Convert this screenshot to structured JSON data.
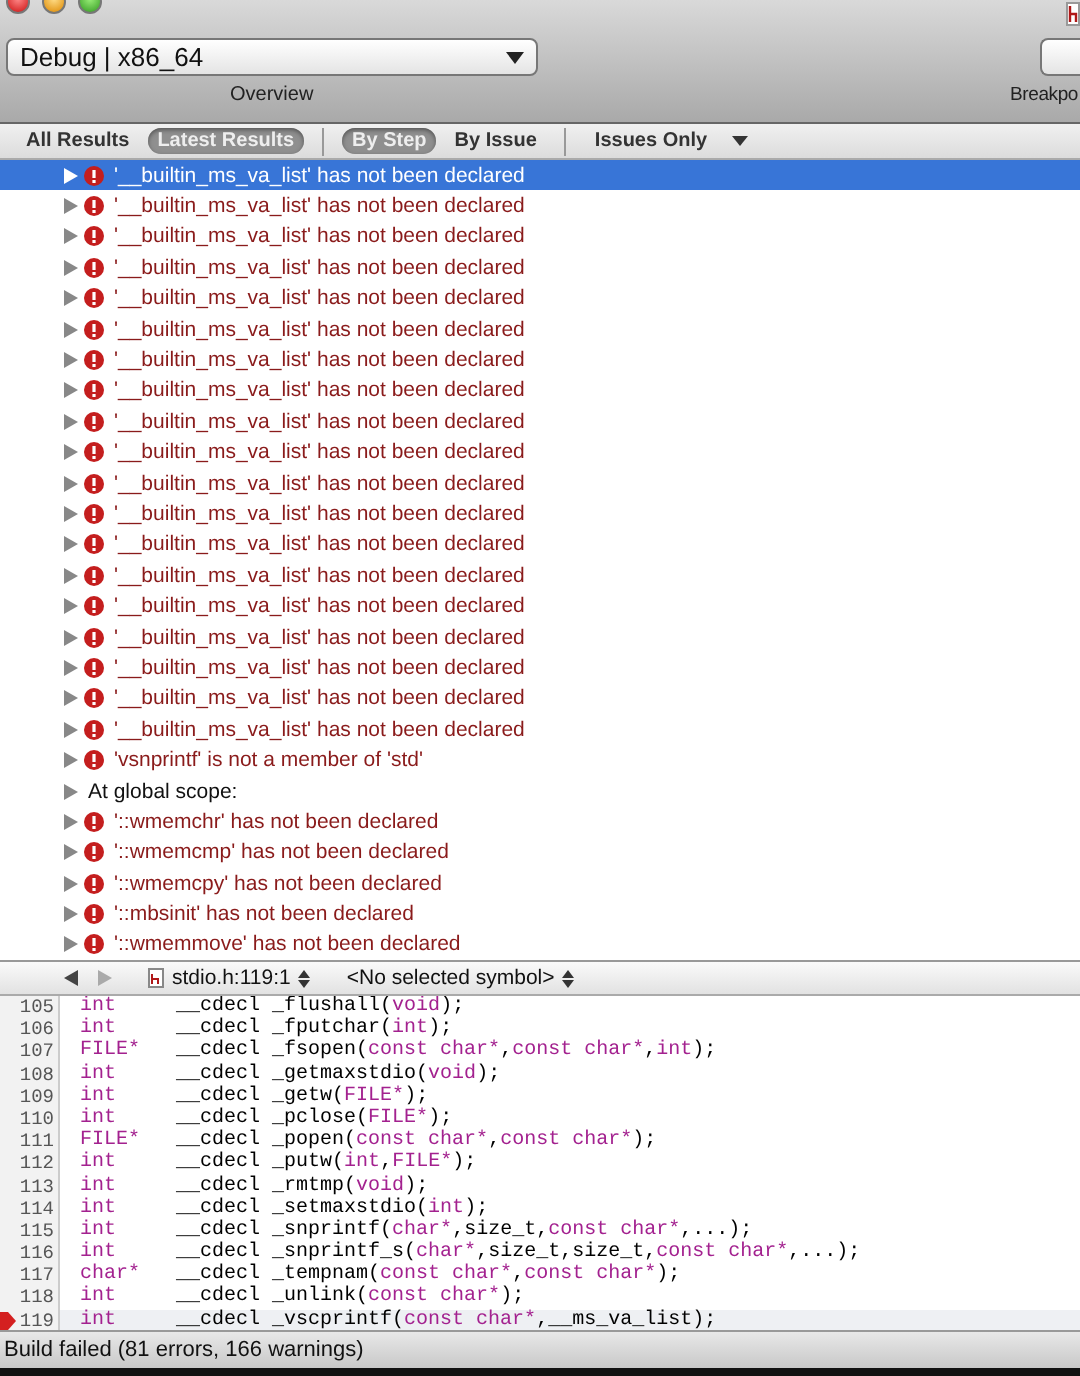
{
  "toolbar": {
    "scheme": "Debug | x86_64",
    "overview_label": "Overview",
    "breakpoints_label": "Breakpo"
  },
  "filter_bar": {
    "groups": [
      [
        {
          "label": "All Results",
          "selected": false
        },
        {
          "label": "Latest Results",
          "selected": true
        }
      ],
      [
        {
          "label": "By Step",
          "selected": true
        },
        {
          "label": "By Issue",
          "selected": false
        }
      ]
    ],
    "issues_filter": "Issues Only"
  },
  "issues": [
    {
      "kind": "error",
      "text": "'__builtin_ms_va_list' has not been declared",
      "selected": true
    },
    {
      "kind": "error",
      "text": "'__builtin_ms_va_list' has not been declared",
      "selected": false
    },
    {
      "kind": "error",
      "text": "'__builtin_ms_va_list' has not been declared",
      "selected": false
    },
    {
      "kind": "error",
      "text": "'__builtin_ms_va_list' has not been declared",
      "selected": false
    },
    {
      "kind": "error",
      "text": "'__builtin_ms_va_list' has not been declared",
      "selected": false
    },
    {
      "kind": "error",
      "text": "'__builtin_ms_va_list' has not been declared",
      "selected": false
    },
    {
      "kind": "error",
      "text": "'__builtin_ms_va_list' has not been declared",
      "selected": false
    },
    {
      "kind": "error",
      "text": "'__builtin_ms_va_list' has not been declared",
      "selected": false
    },
    {
      "kind": "error",
      "text": "'__builtin_ms_va_list' has not been declared",
      "selected": false
    },
    {
      "kind": "error",
      "text": "'__builtin_ms_va_list' has not been declared",
      "selected": false
    },
    {
      "kind": "error",
      "text": "'__builtin_ms_va_list' has not been declared",
      "selected": false
    },
    {
      "kind": "error",
      "text": "'__builtin_ms_va_list' has not been declared",
      "selected": false
    },
    {
      "kind": "error",
      "text": "'__builtin_ms_va_list' has not been declared",
      "selected": false
    },
    {
      "kind": "error",
      "text": "'__builtin_ms_va_list' has not been declared",
      "selected": false
    },
    {
      "kind": "error",
      "text": "'__builtin_ms_va_list' has not been declared",
      "selected": false
    },
    {
      "kind": "error",
      "text": "'__builtin_ms_va_list' has not been declared",
      "selected": false
    },
    {
      "kind": "error",
      "text": "'__builtin_ms_va_list' has not been declared",
      "selected": false
    },
    {
      "kind": "error",
      "text": "'__builtin_ms_va_list' has not been declared",
      "selected": false
    },
    {
      "kind": "error",
      "text": "'__builtin_ms_va_list' has not been declared",
      "selected": false
    },
    {
      "kind": "error",
      "text": "'vsnprintf' is not a member of 'std'",
      "selected": false
    },
    {
      "kind": "group",
      "text": "At global scope:",
      "selected": false
    },
    {
      "kind": "error",
      "text": "'::wmemchr' has not been declared",
      "selected": false
    },
    {
      "kind": "error",
      "text": "'::wmemcmp' has not been declared",
      "selected": false
    },
    {
      "kind": "error",
      "text": "'::wmemcpy' has not been declared",
      "selected": false
    },
    {
      "kind": "error",
      "text": "'::mbsinit' has not been declared",
      "selected": false
    },
    {
      "kind": "error",
      "text": "'::wmemmove' has not been declared",
      "selected": false
    }
  ],
  "editor_bar": {
    "file": "stdio.h:119:1",
    "symbol": "<No selected symbol>"
  },
  "code_lines": [
    {
      "number": "105",
      "error": false,
      "tokens": [
        {
          "kind": "keyword",
          "text": "int"
        },
        {
          "kind": "plain",
          "text": "     __cdecl _flushall("
        },
        {
          "kind": "keyword",
          "text": "void"
        },
        {
          "kind": "plain",
          "text": ");"
        }
      ]
    },
    {
      "number": "106",
      "error": false,
      "tokens": [
        {
          "kind": "keyword",
          "text": "int"
        },
        {
          "kind": "plain",
          "text": "     __cdecl _fputchar("
        },
        {
          "kind": "keyword",
          "text": "int"
        },
        {
          "kind": "plain",
          "text": ");"
        }
      ]
    },
    {
      "number": "107",
      "error": false,
      "tokens": [
        {
          "kind": "keyword",
          "text": "FILE*"
        },
        {
          "kind": "plain",
          "text": "   __cdecl _fsopen("
        },
        {
          "kind": "keyword",
          "text": "const char*"
        },
        {
          "kind": "plain",
          "text": ","
        },
        {
          "kind": "keyword",
          "text": "const char*"
        },
        {
          "kind": "plain",
          "text": ","
        },
        {
          "kind": "keyword",
          "text": "int"
        },
        {
          "kind": "plain",
          "text": ");"
        }
      ]
    },
    {
      "number": "108",
      "error": false,
      "tokens": [
        {
          "kind": "keyword",
          "text": "int"
        },
        {
          "kind": "plain",
          "text": "     __cdecl _getmaxstdio("
        },
        {
          "kind": "keyword",
          "text": "void"
        },
        {
          "kind": "plain",
          "text": ");"
        }
      ]
    },
    {
      "number": "109",
      "error": false,
      "tokens": [
        {
          "kind": "keyword",
          "text": "int"
        },
        {
          "kind": "plain",
          "text": "     __cdecl _getw("
        },
        {
          "kind": "keyword",
          "text": "FILE*"
        },
        {
          "kind": "plain",
          "text": ");"
        }
      ]
    },
    {
      "number": "110",
      "error": false,
      "tokens": [
        {
          "kind": "keyword",
          "text": "int"
        },
        {
          "kind": "plain",
          "text": "     __cdecl _pclose("
        },
        {
          "kind": "keyword",
          "text": "FILE*"
        },
        {
          "kind": "plain",
          "text": ");"
        }
      ]
    },
    {
      "number": "111",
      "error": false,
      "tokens": [
        {
          "kind": "keyword",
          "text": "FILE*"
        },
        {
          "kind": "plain",
          "text": "   __cdecl _popen("
        },
        {
          "kind": "keyword",
          "text": "const char*"
        },
        {
          "kind": "plain",
          "text": ","
        },
        {
          "kind": "keyword",
          "text": "const char*"
        },
        {
          "kind": "plain",
          "text": ");"
        }
      ]
    },
    {
      "number": "112",
      "error": false,
      "tokens": [
        {
          "kind": "keyword",
          "text": "int"
        },
        {
          "kind": "plain",
          "text": "     __cdecl _putw("
        },
        {
          "kind": "keyword",
          "text": "int"
        },
        {
          "kind": "plain",
          "text": ","
        },
        {
          "kind": "keyword",
          "text": "FILE*"
        },
        {
          "kind": "plain",
          "text": ");"
        }
      ]
    },
    {
      "number": "113",
      "error": false,
      "tokens": [
        {
          "kind": "keyword",
          "text": "int"
        },
        {
          "kind": "plain",
          "text": "     __cdecl _rmtmp("
        },
        {
          "kind": "keyword",
          "text": "void"
        },
        {
          "kind": "plain",
          "text": ");"
        }
      ]
    },
    {
      "number": "114",
      "error": false,
      "tokens": [
        {
          "kind": "keyword",
          "text": "int"
        },
        {
          "kind": "plain",
          "text": "     __cdecl _setmaxstdio("
        },
        {
          "kind": "keyword",
          "text": "int"
        },
        {
          "kind": "plain",
          "text": ");"
        }
      ]
    },
    {
      "number": "115",
      "error": false,
      "tokens": [
        {
          "kind": "keyword",
          "text": "int"
        },
        {
          "kind": "plain",
          "text": "     __cdecl _snprintf("
        },
        {
          "kind": "keyword",
          "text": "char*"
        },
        {
          "kind": "plain",
          "text": ",size_t,"
        },
        {
          "kind": "keyword",
          "text": "const char*"
        },
        {
          "kind": "plain",
          "text": ",...);"
        }
      ]
    },
    {
      "number": "116",
      "error": false,
      "tokens": [
        {
          "kind": "keyword",
          "text": "int"
        },
        {
          "kind": "plain",
          "text": "     __cdecl _snprintf_s("
        },
        {
          "kind": "keyword",
          "text": "char*"
        },
        {
          "kind": "plain",
          "text": ",size_t,size_t,"
        },
        {
          "kind": "keyword",
          "text": "const char*"
        },
        {
          "kind": "plain",
          "text": ",...);"
        }
      ]
    },
    {
      "number": "117",
      "error": false,
      "tokens": [
        {
          "kind": "keyword",
          "text": "char*"
        },
        {
          "kind": "plain",
          "text": "   __cdecl _tempnam("
        },
        {
          "kind": "keyword",
          "text": "const char*"
        },
        {
          "kind": "plain",
          "text": ","
        },
        {
          "kind": "keyword",
          "text": "const char*"
        },
        {
          "kind": "plain",
          "text": ");"
        }
      ]
    },
    {
      "number": "118",
      "error": false,
      "tokens": [
        {
          "kind": "keyword",
          "text": "int"
        },
        {
          "kind": "plain",
          "text": "     __cdecl _unlink("
        },
        {
          "kind": "keyword",
          "text": "const char*"
        },
        {
          "kind": "plain",
          "text": ");"
        }
      ]
    },
    {
      "number": "119",
      "error": true,
      "tokens": [
        {
          "kind": "keyword",
          "text": "int"
        },
        {
          "kind": "plain",
          "text": "     __cdecl _vscprintf("
        },
        {
          "kind": "keyword",
          "text": "const char*"
        },
        {
          "kind": "plain",
          "text": ",__ms_va_list);"
        }
      ]
    }
  ],
  "status_bar": "Build failed (81 errors, 166 warnings)"
}
